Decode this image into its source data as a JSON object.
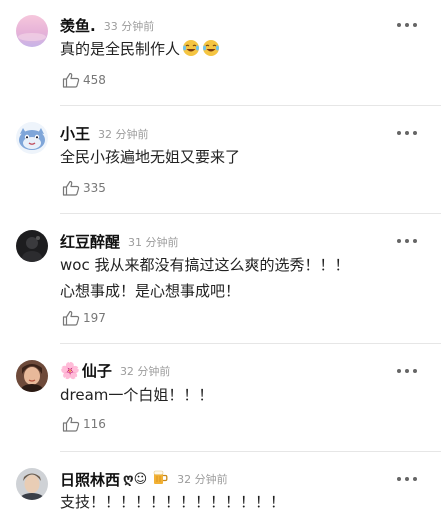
{
  "comments": [
    {
      "username": "羡鱼.",
      "time": "33 分钟前",
      "text": "真的是全民制作人",
      "emoji": "laughing-crying-emoji",
      "likes": "458",
      "avatar": "pink-gradient-avatar"
    },
    {
      "username": "小王",
      "time": "32 分钟前",
      "text": "全民小孩遍地无姐又要来了",
      "likes": "335",
      "avatar": "blue-cartoon-avatar"
    },
    {
      "username": "红豆醉醒",
      "time": "31 分钟前",
      "text_line1": "woc 我从来都没有搞过这么爽的选秀！！！",
      "text_line2": "心想事成！是心想事成吧！",
      "likes": "197",
      "avatar": "dark-photo-avatar"
    },
    {
      "username_flower": "🌸",
      "username": "仙子",
      "time": "32 分钟前",
      "text": "dream一个白姐！！！",
      "likes": "116",
      "avatar": "girl-photo-avatar"
    },
    {
      "username": "日照林西",
      "username_extra": "ღ☺︎",
      "time": "32 分钟前",
      "text": "支技！！！！！！！！！！！！！",
      "avatar": "boy-photo-avatar",
      "badge": "beer-icon"
    }
  ],
  "colors": {
    "username": "#111111",
    "timestamp": "#9c9c9c",
    "divider": "#e6e6e6"
  }
}
